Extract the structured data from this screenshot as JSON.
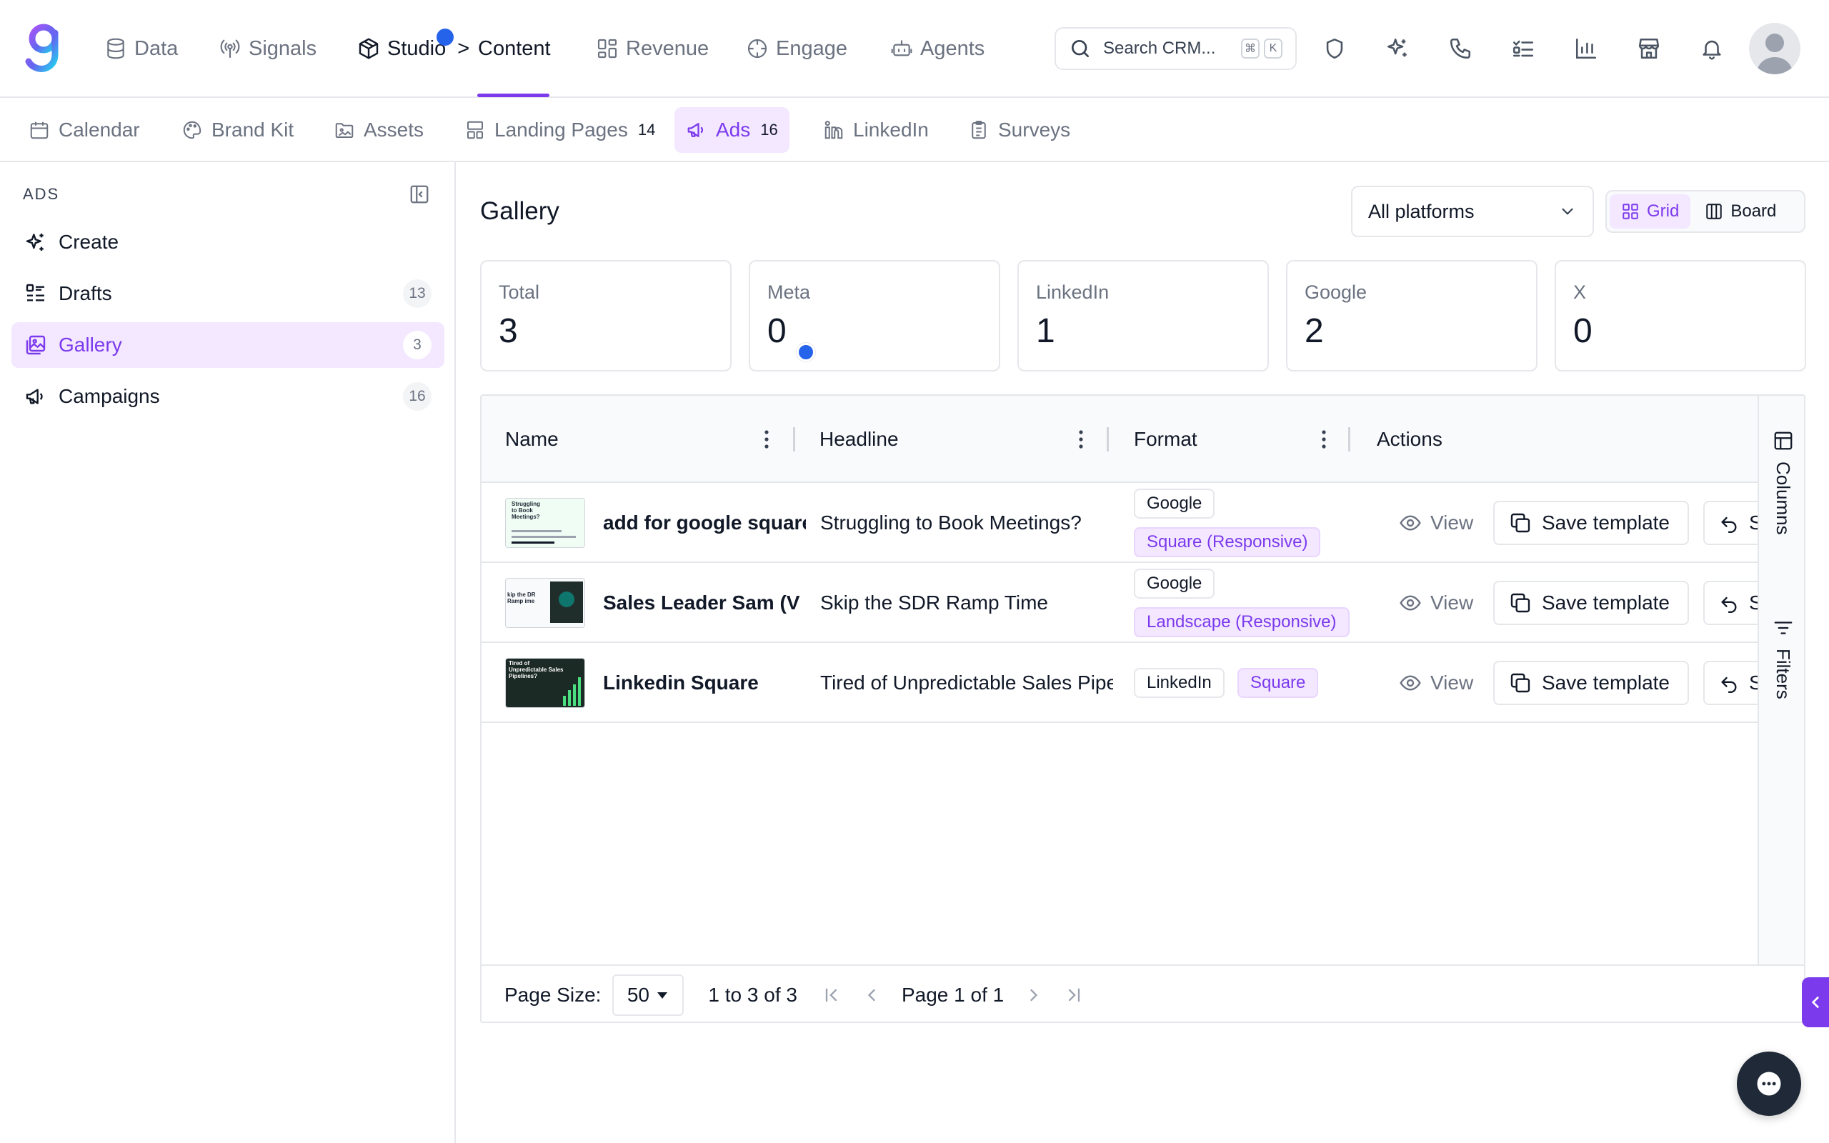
{
  "top_nav": {
    "items": [
      {
        "label": "Data",
        "icon": "database-icon"
      },
      {
        "label": "Signals",
        "icon": "broadcast-icon"
      },
      {
        "label": "Studio",
        "icon": "cube-icon"
      },
      {
        "label": "Content",
        "icon": "none"
      },
      {
        "label": "Revenue",
        "icon": "dashboard-icon"
      },
      {
        "label": "Engage",
        "icon": "crosshair-icon"
      },
      {
        "label": "Agents",
        "icon": "bot-icon"
      }
    ],
    "breadcrumb_separator": ">",
    "active": "Content",
    "search": {
      "placeholder": "Search CRM...",
      "shortcut_keys": [
        "⌘",
        "K"
      ]
    },
    "right_icons": [
      "shield-icon",
      "sparkles-icon",
      "phone-icon",
      "checklist-icon",
      "bar-chart-icon",
      "store-icon",
      "bell-icon"
    ],
    "accent_color": "#7c3aed",
    "notification_color": "#2563eb"
  },
  "sub_nav": {
    "items": [
      {
        "label": "Calendar",
        "count": ""
      },
      {
        "label": "Brand Kit",
        "count": ""
      },
      {
        "label": "Assets",
        "count": ""
      },
      {
        "label": "Landing Pages",
        "count": "14"
      },
      {
        "label": "Ads",
        "count": "16"
      },
      {
        "label": "LinkedIn",
        "count": ""
      },
      {
        "label": "Surveys",
        "count": ""
      }
    ],
    "active": "Ads"
  },
  "sidebar": {
    "title": "ADS",
    "items": [
      {
        "label": "Create",
        "count": ""
      },
      {
        "label": "Drafts",
        "count": "13"
      },
      {
        "label": "Gallery",
        "count": "3"
      },
      {
        "label": "Campaigns",
        "count": "16"
      }
    ],
    "active": "Gallery"
  },
  "main": {
    "title": "Gallery",
    "platform_filter": {
      "selected": "All platforms"
    },
    "view_toggle": {
      "options": [
        "Grid",
        "Board"
      ],
      "active": "Grid"
    },
    "stats": [
      {
        "label": "Total",
        "value": "3"
      },
      {
        "label": "Meta",
        "value": "0"
      },
      {
        "label": "LinkedIn",
        "value": "1"
      },
      {
        "label": "Google",
        "value": "2"
      },
      {
        "label": "X",
        "value": "0"
      }
    ]
  },
  "table": {
    "columns": [
      "Name",
      "Headline",
      "Format",
      "Actions"
    ],
    "rows": [
      {
        "name": "add for google square",
        "headline": "Struggling to Book Meetings?",
        "formats": [
          "Google",
          "Square (Responsive)"
        ],
        "thumbnail_text": "Struggling to Book Meetings?"
      },
      {
        "name": "Sales Leader Sam (V",
        "headline": "Skip the SDR Ramp Time",
        "formats": [
          "Google",
          "Landscape (Responsive)"
        ],
        "thumbnail_text": "kip the DR Ramp ime"
      },
      {
        "name": "Linkedin Square",
        "headline": "Tired of Unpredictable Sales Pipelines?",
        "formats": [
          "LinkedIn",
          "Square"
        ],
        "thumbnail_text": "Tired of Unpredictable Sales Pipelines?"
      }
    ],
    "actions": {
      "view": "View",
      "save_template": "Save template",
      "third": "S"
    },
    "side_tools": [
      "Columns",
      "Filters"
    ],
    "pager": {
      "page_size_label": "Page Size:",
      "page_size": "50",
      "range": "1 to 3 of 3",
      "page_text": "Page",
      "page_current": "1",
      "page_of": "of",
      "page_total": "1"
    }
  }
}
